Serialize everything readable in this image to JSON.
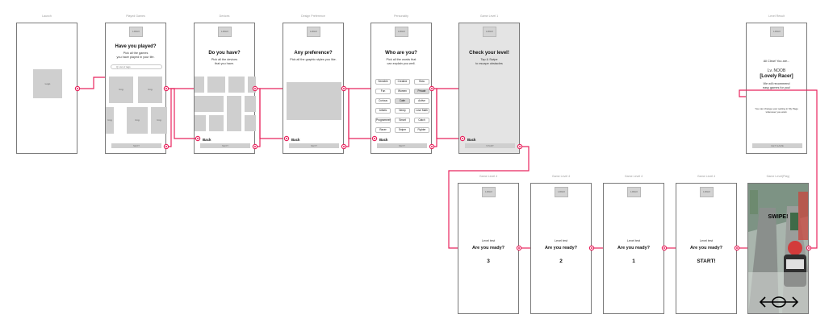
{
  "screens": {
    "launch": {
      "label": "Launch",
      "img": "Logo"
    },
    "played": {
      "label": "Played Games",
      "logo": "LOGO",
      "title": "Have you played?",
      "line1": "Pick all the games",
      "line2": "you have played in your life.",
      "search_placeholder": "Q  List of tags",
      "img": "Img",
      "next": "NEXT"
    },
    "devices": {
      "label": "Devices",
      "logo": "LOGO",
      "title": "Do you have?",
      "line1": "Pick all the devices",
      "line2": "that you have.",
      "back": "Back",
      "next": "NEXT"
    },
    "design": {
      "label": "Design Preference",
      "logo": "LOGO",
      "title": "Any preference?",
      "line1": "Pick all the graphic styles you like.",
      "back": "Back",
      "next": "NEXT"
    },
    "personality": {
      "label": "Personality",
      "logo": "LOGO",
      "title": "Who are you?",
      "line1": "Pick all the words that",
      "line2": "can explain you well.",
      "words": [
        "Sensible",
        "Creative",
        "Slow",
        "Fun",
        "Women",
        "Private",
        "Curious",
        "Calm",
        "Active",
        "Artistic",
        "Nerdy",
        "Love Math",
        "Programmer",
        "Smart",
        "Catch",
        "Racer",
        "Sniper",
        "Fighter"
      ],
      "back": "Back",
      "next": "NEXT"
    },
    "level1": {
      "label": "Game Level 1",
      "logo": "LOGO",
      "title": "Check your level!",
      "line1": "Tap & Swipe",
      "line2": "to escape obstacles",
      "back": "Back",
      "next": "START"
    },
    "level_result": {
      "label": "Level Result",
      "logo": "LOGO",
      "line1": "All Clear! You are...",
      "line2": "Lv. NOOB",
      "line3": "[Lovely Racer]",
      "line4": "We will recommend",
      "line5": "easy games for you!",
      "note1": "You can change your setting in My Page",
      "note2": "whenever you want.",
      "next": "GET GAME"
    },
    "countdown": [
      {
        "label": "Game Level 4",
        "logo": "LOGO",
        "line1": "Level test",
        "line2": "Are you ready?",
        "count": "3"
      },
      {
        "label": "Game Level 4",
        "logo": "LOGO",
        "line1": "Level test",
        "line2": "Are you ready?",
        "count": "2"
      },
      {
        "label": "Game Level 4",
        "logo": "LOGO",
        "line1": "Level test",
        "line2": "Are you ready?",
        "count": "1"
      },
      {
        "label": "Game Level 4",
        "logo": "LOGO",
        "line1": "Level test",
        "line2": "Are you ready?",
        "count": "START!"
      }
    ],
    "play": {
      "label": "Game Level(Play)",
      "swipe": "SWIPE!"
    }
  },
  "colors": {
    "connector": "#e8245e",
    "frame": "#7a7a7a",
    "placeholder": "#cfcfcf",
    "gray_screen": "#e4e4e4"
  },
  "icons": [
    "swipe-left-right-icon",
    "connector-dot-icon"
  ]
}
